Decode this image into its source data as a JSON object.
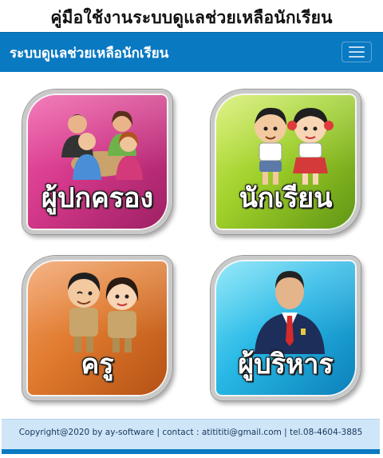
{
  "page": {
    "heading": "คู่มือใช้งานระบบดูแลช่วยเหลือนักเรียน"
  },
  "navbar": {
    "brand": "ระบบดูแลช่วยเหลือนักเรียน",
    "menu_icon": "hamburger-icon"
  },
  "tiles": [
    {
      "label": "ผู้ปกครอง",
      "icon": "parents-group-icon",
      "color": "#d4388a"
    },
    {
      "label": "นักเรียน",
      "icon": "students-cartoon-icon",
      "color": "#9fd02a"
    },
    {
      "label": "ครู",
      "icon": "teachers-cartoon-icon",
      "color": "#e07a2e"
    },
    {
      "label": "ผู้บริหาร",
      "icon": "executive-icon",
      "color": "#28b8e6"
    }
  ],
  "footer": {
    "text": "Copyright@2020 by ay-software | contact : atitititi@gmail.com | tel.08-4604-3885"
  },
  "colors": {
    "navbar": "#0979c2",
    "footer_bg": "#cfe6f8"
  }
}
